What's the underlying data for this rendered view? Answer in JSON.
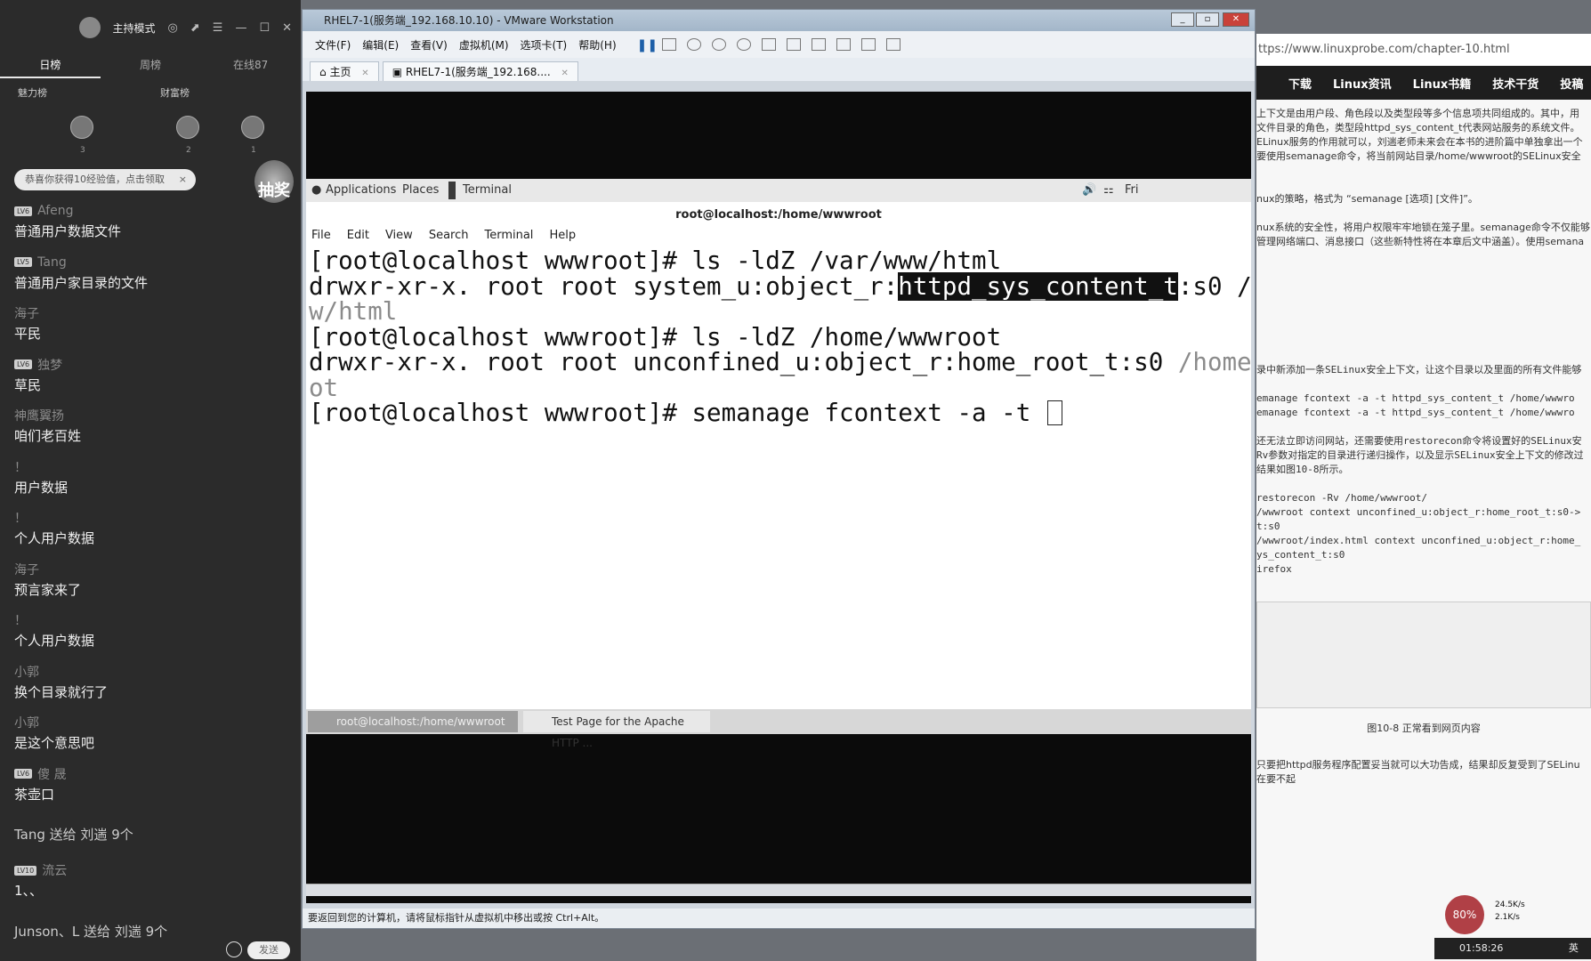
{
  "chat": {
    "mode": "主持模式",
    "tabs": [
      "日榜",
      "周榜",
      "在线87"
    ],
    "rank_labels": [
      "魅力榜",
      "财富榜"
    ],
    "rank_numbers": [
      "3",
      "2",
      "1"
    ],
    "notice": "恭喜你获得10经验值，点击领取",
    "notice_close": "×",
    "lottery": "抽奖",
    "messages": [
      {
        "level": "LV6",
        "user": "Afeng",
        "text": "普通用户数据文件"
      },
      {
        "level": "LV5",
        "user": "Tang",
        "text": "普通用户家目录的文件"
      },
      {
        "level": "",
        "user": "海子",
        "text": "平民"
      },
      {
        "level": "LV6",
        "user": "独梦",
        "text": "草民"
      },
      {
        "level": "",
        "user": "神鹰翼扬",
        "text": "咱们老百姓"
      },
      {
        "level": "",
        "user": "！",
        "text": "用户数据"
      },
      {
        "level": "",
        "user": "！",
        "text": "个人用户数据"
      },
      {
        "level": "",
        "user": "海子",
        "text": "预言家来了"
      },
      {
        "level": "",
        "user": "！",
        "text": "个人用户数据"
      },
      {
        "level": "",
        "user": "小郭",
        "text": "换个目录就行了"
      },
      {
        "level": "",
        "user": "小郭",
        "text": "是这个意思吧"
      },
      {
        "level": "LV6",
        "user": "傻 晟",
        "text": "茶壶口"
      },
      {
        "level": "",
        "user": "",
        "text": "Tang 送给 刘遄 9个"
      },
      {
        "level": "LV10",
        "user": "流云",
        "text": "1、、"
      },
      {
        "level": "",
        "user": "",
        "text": "Junson、L 送给 刘遄 9个"
      }
    ],
    "send": "发送"
  },
  "vmware": {
    "title": "RHEL7-1(服务端_192.168.10.10) - VMware Workstation",
    "menu": [
      "文件(F)",
      "编辑(E)",
      "查看(V)",
      "虚拟机(M)",
      "选项卡(T)",
      "帮助(H)"
    ],
    "tabs": [
      "主页",
      "RHEL7-1(服务端_192.168...."
    ],
    "status": "要返回到您的计算机，请将鼠标指针从虚拟机中移出或按 Ctrl+Alt。"
  },
  "guest": {
    "gnome_applications": "Applications",
    "gnome_places": "Places",
    "gnome_terminal": "Terminal",
    "gnome_day": "Fri",
    "terminal_title": "root@localhost:/home/wwwroot",
    "terminal_menu": [
      "File",
      "Edit",
      "View",
      "Search",
      "Terminal",
      "Help"
    ],
    "lines": {
      "l1": "[root@localhost wwwroot]# ls -ldZ /var/www/html",
      "l2_pre": "drwxr-xr-x. root root system_u:object_r:",
      "l2_hl": "httpd_sys_content_t",
      "l2_post": ":s0 /",
      "l3": "w/html",
      "l4": "[root@localhost wwwroot]# ls -ldZ /home/wwwroot",
      "l5_pre": "drwxr-xr-x. root root unconfined_u:object_r:home_root_t:s0 ",
      "l5_dim": "/home",
      "l6": "ot",
      "l7": "[root@localhost wwwroot]# semanage fcontext -a -t "
    },
    "taskbar": [
      "root@localhost:/home/wwwroot",
      "Test Page for the Apache HTTP ..."
    ]
  },
  "browser": {
    "url": "ttps://www.linuxprobe.com/chapter-10.html",
    "nav": [
      "下载",
      "Linux资讯",
      "Linux书籍",
      "技术干货",
      "投稿"
    ],
    "text_lines": [
      "上下文是由用户段、角色段以及类型段等多个信息项共同组成的。其中，用",
      "文件目录的角色，类型段httpd_sys_content_t代表网站服务的系统文件。",
      "ELinux服务的作用就可以，刘遄老师未来会在本书的进阶篇中单独拿出一个",
      "要使用semanage命令，将当前网站目录/home/wwwroot的SELinux安全",
      "",
      "",
      "nux的策略，格式为 “semanage [选项] [文件]”。",
      "",
      "nux系统的安全性，将用户权限牢牢地锁在笼子里。semanage命令不仅能够",
      "管理网络端口、消息接口（这些新特性将在本章后文中涵盖）。使用semana"
    ],
    "text_lines2": [
      "录中新添加一条SELinux安全上下文，让这个目录以及里面的所有文件能够",
      "",
      "emanage fcontext -a -t httpd_sys_content_t /home/wwwro",
      "emanage fcontext -a -t httpd_sys_content_t /home/wwwro",
      "",
      "还无法立即访问网站，还需要使用restorecon命令将设置好的SELinux安",
      "Rv参数对指定的目录进行递归操作，以及显示SELinux安全上下文的修改过",
      "结果如图10-8所示。",
      "",
      "restorecon -Rv /home/wwwroot/",
      "/wwwroot context unconfined_u:object_r:home_root_t:s0->",
      "t:s0",
      "/wwwroot/index.html context unconfined_u:object_r:home_",
      "ys_content_t:s0",
      "irefox"
    ],
    "caption": "图10-8  正常看到网页内容",
    "bottom_line": "只要把httpd服务程序配置妥当就可以大功告成，结果却反复受到了SELinu",
    "bottom_line2": "在要不起",
    "cpu": "80%",
    "up": "24.5K/s",
    "down": "2.1K/s",
    "time": "01:58:26",
    "ime": "英"
  }
}
